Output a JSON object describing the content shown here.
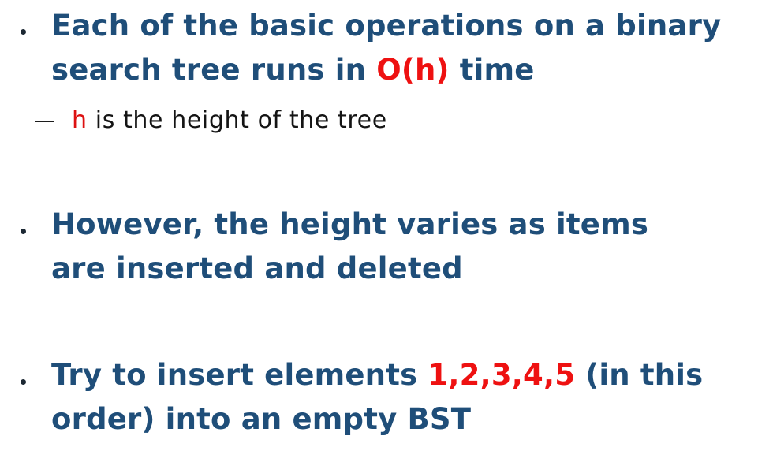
{
  "bullets": [
    {
      "parts": [
        "Each of the basic operations on a binary search tree runs in ",
        "O(h)",
        " time"
      ],
      "sub": {
        "parts": [
          "h",
          " is the height of the tree"
        ]
      }
    },
    {
      "parts": [
        "However, the height varies as items are inserted and deleted"
      ]
    },
    {
      "parts": [
        "Try to insert elements ",
        "1,2,3,4,5",
        " (in this order) into an empty BST"
      ]
    }
  ],
  "colors": {
    "text": "#1f4e79",
    "highlight": "#ee1111",
    "subtext": "#141414"
  }
}
